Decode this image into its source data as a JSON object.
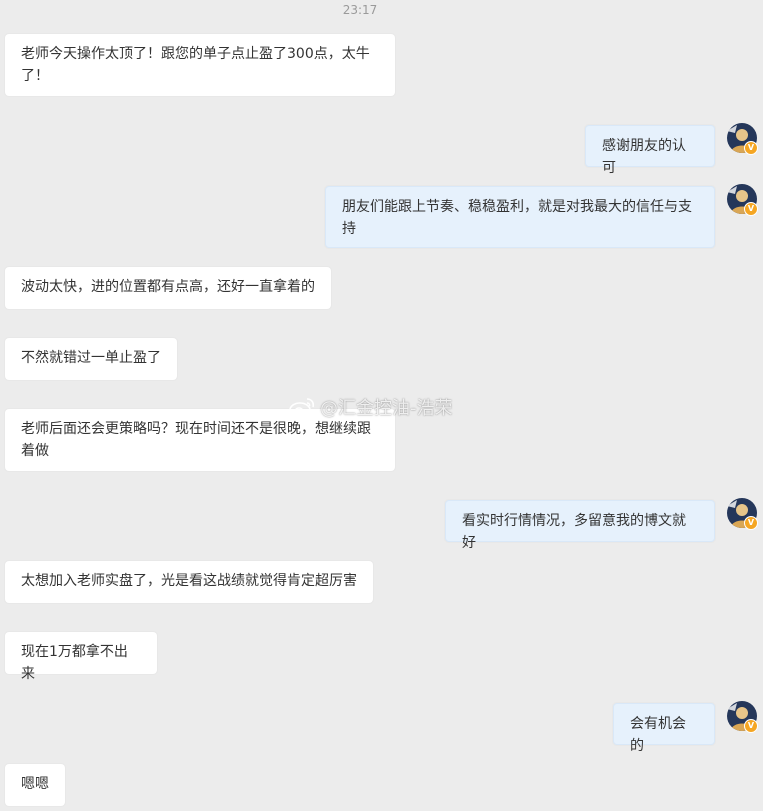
{
  "chat": {
    "timestamp": "23:17",
    "messages": [
      {
        "side": "in",
        "text": "老师今天操作太顶了！跟您的单子点止盈了300点，太牛了！"
      },
      {
        "side": "out",
        "text": "感谢朋友的认可"
      },
      {
        "side": "out",
        "text": "朋友们能跟上节奏、稳稳盈利，就是对我最大的信任与支持"
      },
      {
        "side": "in",
        "text": "波动太快，进的位置都有点高，还好一直拿着的"
      },
      {
        "side": "in",
        "text": "不然就错过一单止盈了"
      },
      {
        "side": "in",
        "text": "老师后面还会更策略吗？现在时间还不是很晚，想继续跟着做"
      },
      {
        "side": "out",
        "text": "看实时行情情况，多留意我的博文就好"
      },
      {
        "side": "in",
        "text": "太想加入老师实盘了，光是看这战绩就觉得肯定超厉害"
      },
      {
        "side": "in",
        "text": "现在1万都拿不出来"
      },
      {
        "side": "out",
        "text": "会有机会的"
      },
      {
        "side": "in",
        "text": "嗯嗯"
      }
    ],
    "avatar_badge": "V",
    "avatar_icon": "user-avatar-icon",
    "badge_color": "#f5a623"
  },
  "watermark": {
    "text": "@汇金控油-浩荣",
    "icon": "weibo-logo-icon"
  }
}
